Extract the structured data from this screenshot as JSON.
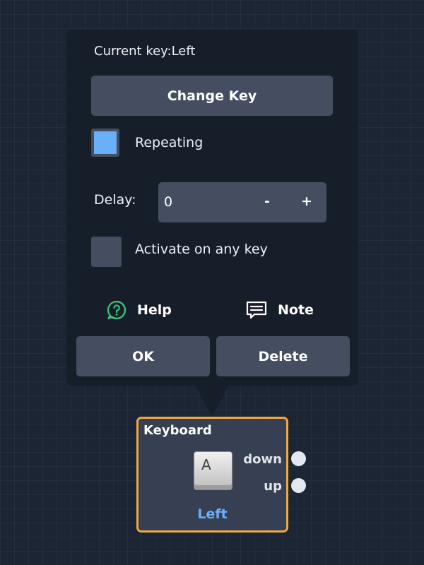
{
  "popup": {
    "current_key_label": "Current key:Left",
    "change_key_label": "Change Key",
    "repeating_label": "Repeating",
    "repeating_checked": true,
    "delay_label": "Delay:",
    "delay_value": "0",
    "delay_minus": "-",
    "delay_plus": "+",
    "activate_label": "Activate on any key",
    "activate_checked": false,
    "help_label": "Help",
    "note_label": "Note",
    "ok_label": "OK",
    "delete_label": "Delete"
  },
  "node": {
    "title": "Keyboard",
    "key_glyph": "A",
    "key_name": "Left",
    "ports": [
      "down",
      "up"
    ]
  },
  "icons": {
    "help": "help-circle-icon",
    "note": "note-icon"
  },
  "colors": {
    "background": "#1c2533",
    "panel": "#161e2a",
    "button": "#444e60",
    "accent_blue": "#69aff9",
    "node_border": "#f3a641",
    "help_green": "#3ec27a"
  }
}
